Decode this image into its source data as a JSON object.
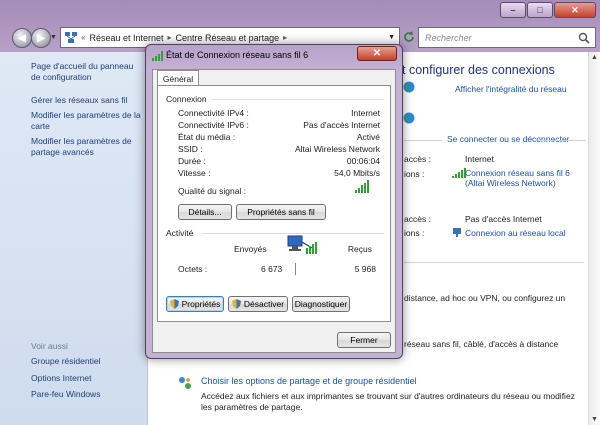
{
  "window": {
    "breadcrumb": [
      "Réseau et Internet",
      "Centre Réseau et partage"
    ],
    "breadcrumb_prefix": "«",
    "search_placeholder": "Rechercher"
  },
  "left_pane": {
    "links": [
      "Page d'accueil du panneau de configuration",
      "Gérer les réseaux sans fil",
      "Modifier les paramètres de la carte",
      "Modifier les paramètres de partage avancés"
    ],
    "see_also_heading": "Voir aussi",
    "see_also": [
      "Groupe résidentiel",
      "Options Internet",
      "Pare-feu Windows"
    ]
  },
  "content": {
    "title": "t configurer des connexions",
    "view_full_map": "Afficher l'intégralité du réseau",
    "connect_disconnect": "Se connecter ou se déconnecter",
    "net1_access_label": "accès :",
    "net1_access_value": "Internet",
    "net1_conn_label": "ions :",
    "net1_conn_value_line1": "Connexion réseau sans fil 6",
    "net1_conn_value_line2": "(Altai Wireless Network)",
    "net2_access_label": "accès :",
    "net2_access_value": "Pas d'accès Internet",
    "net2_conn_label": "ions :",
    "net2_conn_value": "Connexion au réseau local",
    "setup_line1": "distance, ad hoc ou VPN, ou configurez un",
    "setup_line2": "réseau sans fil, câblé, d'accès à distance",
    "share_title": "Choisir les options de partage et de groupe résidentiel",
    "share_desc_line1": "Accédez aux fichiers et aux imprimantes se trouvant sur d'autres ordinateurs du réseau ou modifiez",
    "share_desc_line2": "les paramètres de partage."
  },
  "dialog": {
    "title": "État de Connexion réseau sans fil 6",
    "tab": "Général",
    "connection_heading": "Connexion",
    "rows": [
      {
        "label": "Connectivité IPv4 :",
        "value": "Internet"
      },
      {
        "label": "Connectivité IPv6 :",
        "value": "Pas d'accès Internet"
      },
      {
        "label": "État du média :",
        "value": "Activé"
      },
      {
        "label": "SSID :",
        "value": "Altai Wireless Network"
      },
      {
        "label": "Durée :",
        "value": "00:06:04"
      },
      {
        "label": "Vitesse :",
        "value": "54,0 Mbits/s"
      }
    ],
    "signal_label": "Qualité du signal :",
    "details_button": "Détails...",
    "wireless_props_button": "Propriétés sans fil",
    "activity_heading": "Activité",
    "sent_label": "Envoyés",
    "received_label": "Reçus",
    "bytes_label": "Octets :",
    "bytes_sent": "6 673",
    "bytes_received": "5 968",
    "properties_button": "Propriétés",
    "disable_button": "Désactiver",
    "diagnose_button": "Diagnostiquer",
    "close_button": "Fermer"
  }
}
